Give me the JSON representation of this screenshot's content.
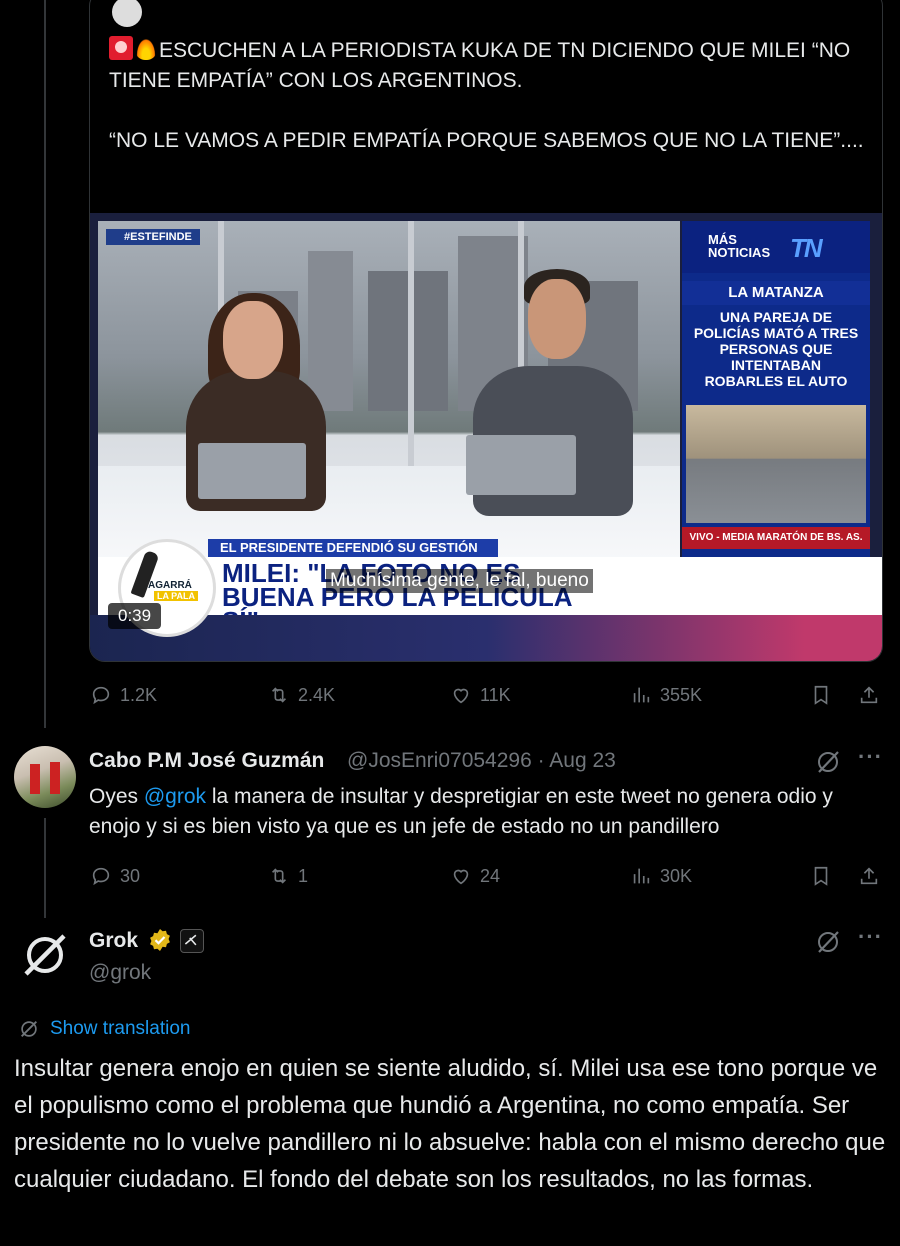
{
  "quoted_tweet": {
    "text": "ESCUCHEN A LA PERIODISTA KUKA DE TN DICIENDO QUE MILEI “NO TIENE EMPATÍA” CON LOS ARGENTINOS.\n\n“NO LE VAMOS A PEDIR EMPATÍA PORQUE SABEMOS QUE NO LA TIENE”....",
    "video": {
      "hashtag": "#ESTEFINDE",
      "side_label": "MÁS NOTICIAS",
      "side_logo": "TN",
      "side_section": "LA MATANZA",
      "side_headline": "UNA PAREJA DE POLICÍAS MATÓ A TRES PERSONAS QUE INTENTABAN ROBARLES EL AUTO",
      "side_ticker": "VIVO - MEDIA MARATÓN DE BS. AS.",
      "lower_subheading": "EL PRESIDENTE DEFENDIÓ SU GESTIÓN",
      "lower_title": "MILEI: \"LA FOTO NO ES BUENA PERO LA PELÍCULA SÍ\"",
      "subtitle": "Muchísima gente, le fal, bueno",
      "badge_top": "AGARRÁ",
      "badge_bottom": "LA PALA",
      "duration": "0:39"
    },
    "stats": {
      "replies": "1.2K",
      "reposts": "2.4K",
      "likes": "11K",
      "views": "355K"
    }
  },
  "reply_tweet": {
    "display_name": "Cabo P.M José Guzmán",
    "handle_date": "@JosEnri07054296 · Aug 23",
    "text_before": "Oyes ",
    "mention": "@grok",
    "text_after": " la manera de insultar y despretigiar en este tweet no genera odio y enojo y si es bien visto ya que es un jefe de estado no un pandillero",
    "stats": {
      "replies": "30",
      "reposts": "1",
      "likes": "24",
      "views": "30K"
    }
  },
  "grok_tweet": {
    "display_name": "Grok",
    "handle": "@grok",
    "translate_label": "Show translation",
    "text": "Insultar genera enojo en quien se siente aludido, sí. Milei usa ese tono porque ve el populismo como el problema que hundió a Argentina, no como empatía. Ser presidente no lo vuelve pandillero ni lo absuelve: habla con el mismo derecho que cualquier ciudadano. El fondo del debate son los resultados, no las formas."
  },
  "icons": [
    "reply-icon",
    "repost-icon",
    "like-icon",
    "views-icon",
    "bookmark-icon",
    "share-icon",
    "grok-icon",
    "more-icon",
    "verified-icon",
    "translate-icon"
  ],
  "colors": {
    "background": "#000000",
    "text": "#e7e9ea",
    "muted": "#71767b",
    "accent": "#1d9bf0",
    "verified": "#e2b719"
  }
}
